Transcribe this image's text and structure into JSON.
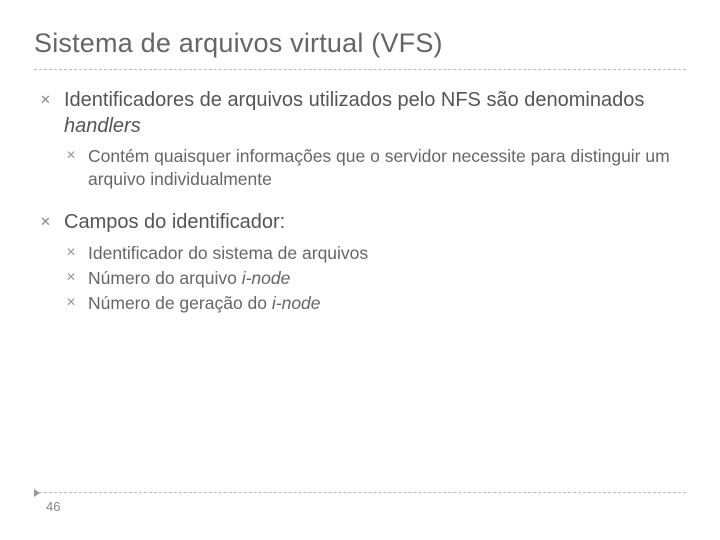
{
  "title": "Sistema de arquivos virtual (VFS)",
  "bullets": {
    "b1_pre": "Identificadores de arquivos utilizados pelo NFS são denominados ",
    "b1_em": "handlers",
    "b1_sub1": "Contém quaisquer informações que o servidor necessite para distinguir um arquivo individualmente",
    "b2": "Campos do identificador:",
    "b2_sub1": "Identificador do sistema de arquivos",
    "b2_sub2_pre": "Número do arquivo ",
    "b2_sub2_em": "i-node",
    "b2_sub3_pre": "Número de geração do ",
    "b2_sub3_em": "i-node"
  },
  "page_number": "46"
}
